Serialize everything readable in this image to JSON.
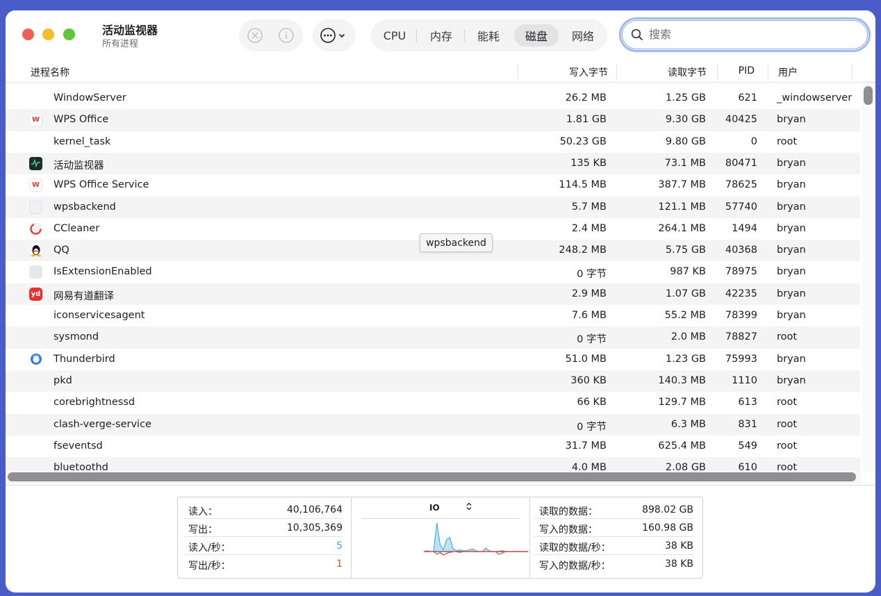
{
  "window": {
    "title": "活动监视器",
    "subtitle": "所有进程"
  },
  "toolbar": {
    "stop_icon": "x-circle-icon",
    "info_icon": "info-icon",
    "more_icon": "ellipsis-circle-icon",
    "tabs": [
      "CPU",
      "内存",
      "能耗",
      "磁盘",
      "网络"
    ],
    "active_tab": "磁盘"
  },
  "search": {
    "placeholder": "搜索",
    "value": ""
  },
  "columns": [
    "进程名称",
    "写入字节",
    "读取字节",
    "PID",
    "用户"
  ],
  "processes": [
    {
      "icon": "none",
      "name": "WindowServer",
      "written": "26.2 MB",
      "read": "1.25 GB",
      "pid": "621",
      "user": "_windowserver"
    },
    {
      "icon": "wps-icon",
      "name": "WPS Office",
      "written": "1.81 GB",
      "read": "9.30 GB",
      "pid": "40425",
      "user": "bryan"
    },
    {
      "icon": "none",
      "name": "kernel_task",
      "written": "50.23 GB",
      "read": "9.80 GB",
      "pid": "0",
      "user": "root"
    },
    {
      "icon": "activity-monitor-icon",
      "name": "活动监视器",
      "written": "135 KB",
      "read": "73.1 MB",
      "pid": "80471",
      "user": "bryan"
    },
    {
      "icon": "wps-icon",
      "name": "WPS Office Service",
      "written": "114.5 MB",
      "read": "387.7 MB",
      "pid": "78625",
      "user": "bryan"
    },
    {
      "icon": "generic-app-icon",
      "name": "wpsbackend",
      "written": "5.7 MB",
      "read": "121.1 MB",
      "pid": "57740",
      "user": "bryan"
    },
    {
      "icon": "ccleaner-icon",
      "name": "CCleaner",
      "written": "2.4 MB",
      "read": "264.1 MB",
      "pid": "1494",
      "user": "bryan"
    },
    {
      "icon": "qq-icon",
      "name": "QQ",
      "written": "248.2 MB",
      "read": "5.75 GB",
      "pid": "40368",
      "user": "bryan"
    },
    {
      "icon": "extension-icon",
      "name": "IsExtensionEnabled",
      "written": "0 字节",
      "read": "987 KB",
      "pid": "78975",
      "user": "bryan"
    },
    {
      "icon": "youdao-icon",
      "name": "网易有道翻译",
      "written": "2.9 MB",
      "read": "1.07 GB",
      "pid": "42235",
      "user": "bryan"
    },
    {
      "icon": "none",
      "name": "iconservicesagent",
      "written": "7.6 MB",
      "read": "55.2 MB",
      "pid": "78399",
      "user": "bryan"
    },
    {
      "icon": "none",
      "name": "sysmond",
      "written": "0 字节",
      "read": "2.0 MB",
      "pid": "78827",
      "user": "root"
    },
    {
      "icon": "thunderbird-icon",
      "name": "Thunderbird",
      "written": "51.0 MB",
      "read": "1.23 GB",
      "pid": "75993",
      "user": "bryan"
    },
    {
      "icon": "none",
      "name": "pkd",
      "written": "360 KB",
      "read": "140.3 MB",
      "pid": "1110",
      "user": "bryan"
    },
    {
      "icon": "none",
      "name": "corebrightnessd",
      "written": "66 KB",
      "read": "129.7 MB",
      "pid": "613",
      "user": "root"
    },
    {
      "icon": "none",
      "name": "clash-verge-service",
      "written": "0 字节",
      "read": "6.3 MB",
      "pid": "831",
      "user": "root"
    },
    {
      "icon": "none",
      "name": "fseventsd",
      "written": "31.7 MB",
      "read": "625.4 MB",
      "pid": "549",
      "user": "root"
    },
    {
      "icon": "none",
      "name": "bluetoothd",
      "written": "4.0 MB",
      "read": "2.08 GB",
      "pid": "610",
      "user": "root"
    }
  ],
  "tooltip": "wpsbackend",
  "stats_left": [
    {
      "label": "读入：",
      "value": "40,106,764",
      "color": "#1d1d1f"
    },
    {
      "label": "写出：",
      "value": "10,305,369",
      "color": "#1d1d1f"
    },
    {
      "label": "读入/秒：",
      "value": "5",
      "color": "#3fa9d8"
    },
    {
      "label": "写出/秒：",
      "value": "1",
      "color": "#e8413a"
    }
  ],
  "io_graph": {
    "title": "IO",
    "read_color": "#4aaedc",
    "write_color": "#e8413a",
    "read_series": [
      0,
      1,
      0,
      0,
      33,
      8,
      2,
      14,
      16,
      3,
      1,
      2,
      1,
      1,
      2,
      3,
      1,
      0,
      0,
      4,
      1,
      0,
      0,
      0,
      1,
      0,
      0,
      0,
      0,
      0,
      0,
      0,
      0
    ],
    "write_series": [
      0,
      0,
      0,
      0,
      -3,
      -1,
      -4,
      -2,
      -1,
      0,
      0,
      -1,
      0,
      0,
      0,
      0,
      0,
      0,
      0,
      0,
      0,
      0,
      0,
      -3,
      -2,
      0,
      0,
      0,
      0,
      0,
      0,
      0,
      0
    ]
  },
  "stats_right": [
    {
      "label": "读取的数据：",
      "value": "898.02 GB"
    },
    {
      "label": "写入的数据：",
      "value": "160.98 GB"
    },
    {
      "label": "读取的数据/秒：",
      "value": "38 KB"
    },
    {
      "label": "写入的数据/秒：",
      "value": "38 KB"
    }
  ]
}
